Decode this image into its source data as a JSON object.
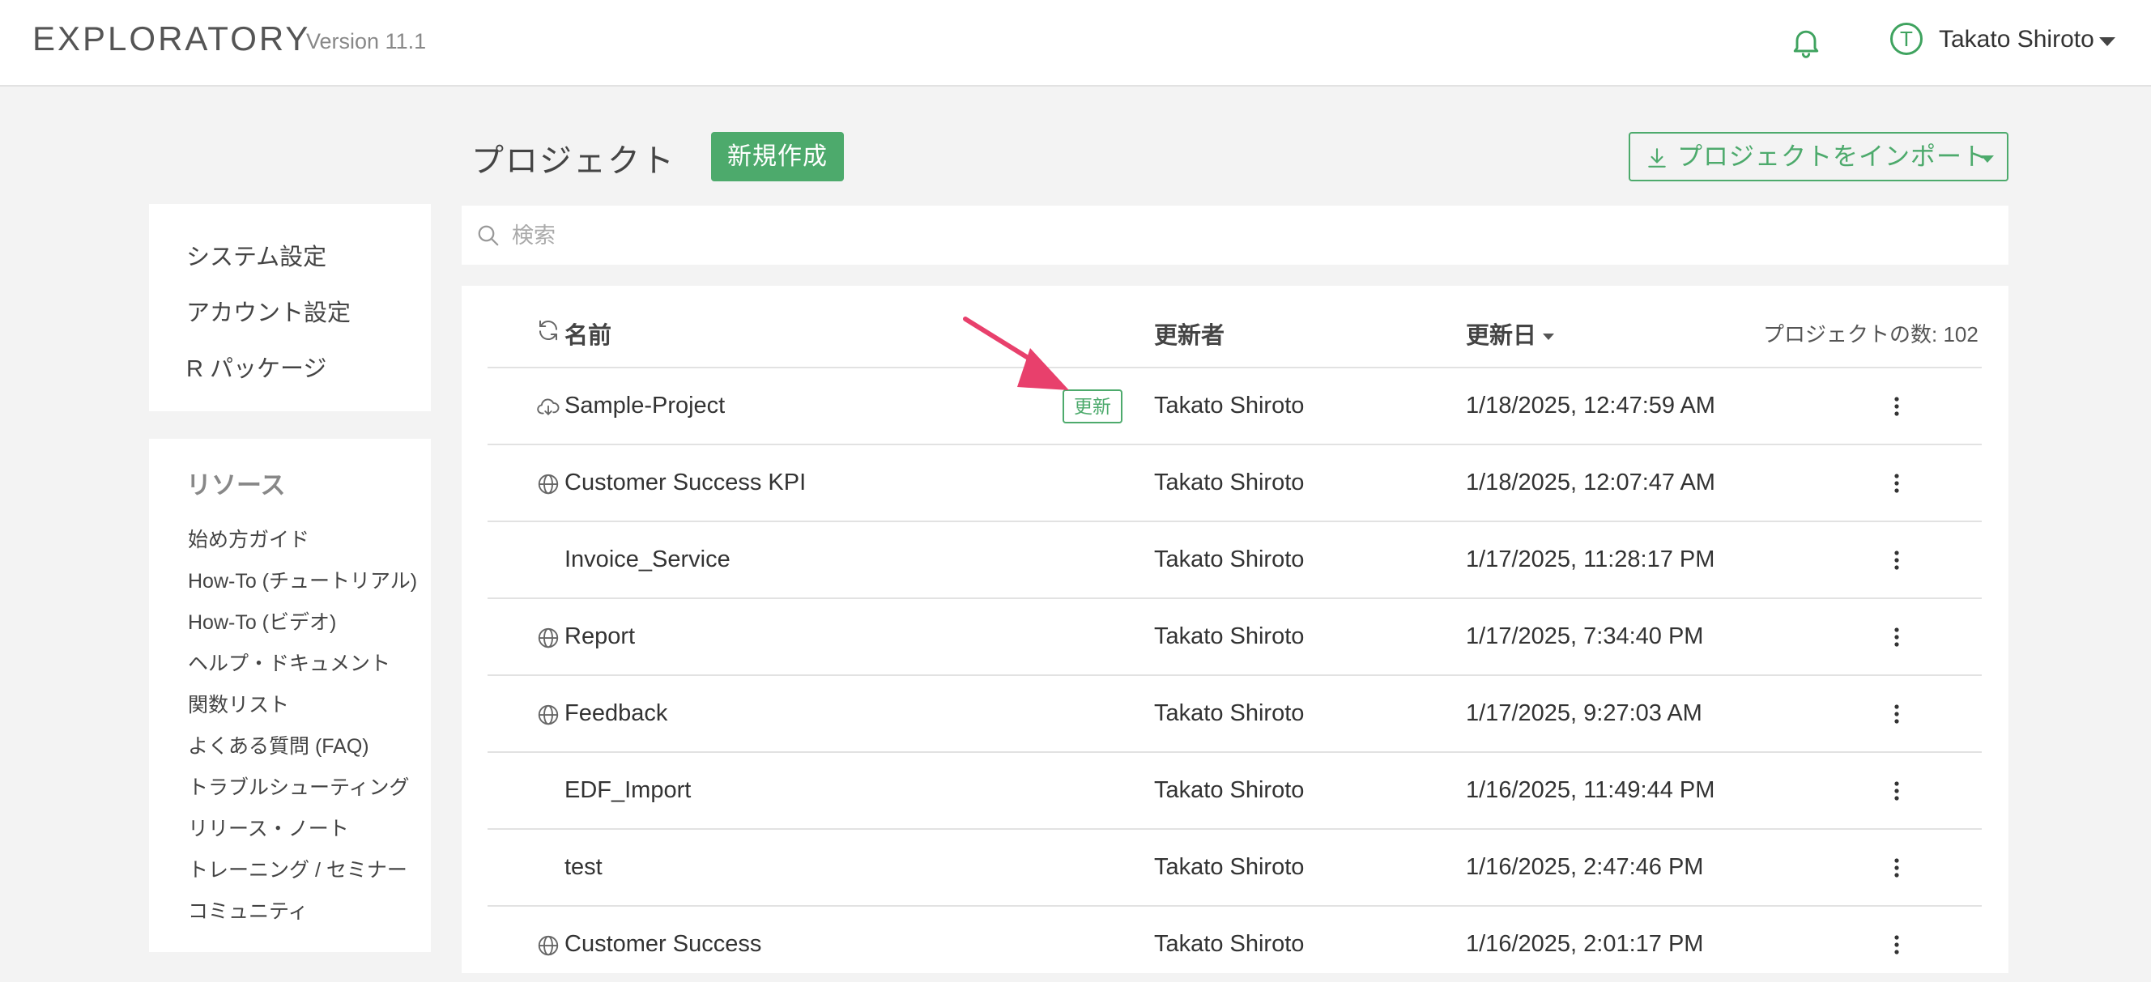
{
  "app": {
    "brand": "EXPLORATORY",
    "version": "Version 11.1",
    "icons": {
      "notifications": "bell-icon",
      "user_menu": "caret-down-icon"
    },
    "user": {
      "initial": "T",
      "name": "Takato Shiroto"
    },
    "accent_color": "#4daa6c"
  },
  "sidebar": {
    "settings": [
      "システム設定",
      "アカウント設定",
      "R パッケージ"
    ],
    "resources_title": "リソース",
    "resources": [
      "始め方ガイド",
      "How-To (チュートリアル)",
      "How-To (ビデオ)",
      "ヘルプ・ドキュメント",
      "関数リスト",
      "よくある質問 (FAQ)",
      "トラブルシューティング",
      "リリース・ノート",
      "トレーニング / セミナー",
      "コミュニティ"
    ]
  },
  "main": {
    "title": "プロジェクト",
    "new_button": "新規作成",
    "import_button": "プロジェクトをインポート",
    "search_placeholder": "検索",
    "columns": {
      "name": "名前",
      "owner": "更新者",
      "date": "更新日"
    },
    "sort": {
      "column": "date",
      "direction": "descending"
    },
    "project_count": "プロジェクトの数: 102",
    "update_badge": "更新",
    "rows": [
      {
        "icon": "cloud-download-icon",
        "name": "Sample-Project",
        "owner": "Takato Shiroto",
        "date": "1/18/2025, 12:47:59 AM",
        "badge": true
      },
      {
        "icon": "globe-icon",
        "name": "Customer Success KPI",
        "owner": "Takato Shiroto",
        "date": "1/18/2025, 12:07:47 AM",
        "badge": false
      },
      {
        "icon": "",
        "name": "Invoice_Service",
        "owner": "Takato Shiroto",
        "date": "1/17/2025, 11:28:17 PM",
        "badge": false
      },
      {
        "icon": "globe-icon",
        "name": "Report",
        "owner": "Takato Shiroto",
        "date": "1/17/2025, 7:34:40 PM",
        "badge": false
      },
      {
        "icon": "globe-icon",
        "name": "Feedback",
        "owner": "Takato Shiroto",
        "date": "1/17/2025, 9:27:03 AM",
        "badge": false
      },
      {
        "icon": "",
        "name": "EDF_Import",
        "owner": "Takato Shiroto",
        "date": "1/16/2025, 11:49:44 PM",
        "badge": false
      },
      {
        "icon": "",
        "name": "test",
        "owner": "Takato Shiroto",
        "date": "1/16/2025, 2:47:46 PM",
        "badge": false
      },
      {
        "icon": "globe-icon",
        "name": "Customer Success",
        "owner": "Takato Shiroto",
        "date": "1/16/2025, 2:01:17 PM",
        "badge": false
      }
    ]
  },
  "annotation": {
    "arrow_color": "#e8406c"
  }
}
